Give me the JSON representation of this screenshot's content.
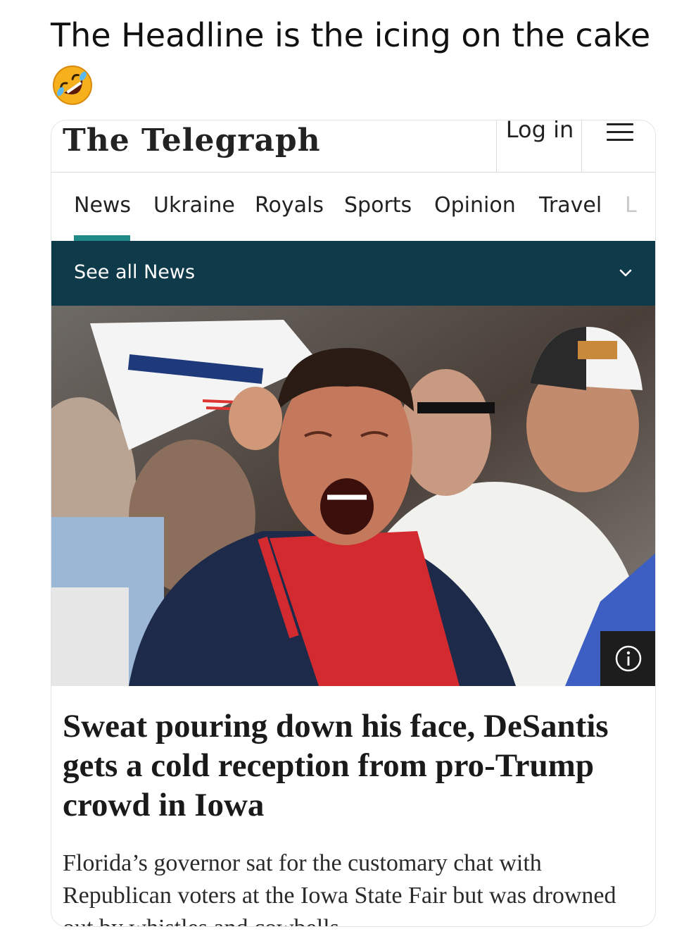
{
  "tweet": {
    "text": "The Headline is the icing on the cake",
    "emoji_icon": "rolling-on-floor-laughing-emoji"
  },
  "site": {
    "brand": "The Telegraph",
    "login_label": "Log in",
    "menu_icon": "hamburger-menu-icon"
  },
  "nav": {
    "items": [
      "News",
      "Ukraine",
      "Royals",
      "Sports",
      "Opinion",
      "Travel"
    ],
    "overflow_hint": "L",
    "active": "News"
  },
  "subnav": {
    "label": "See all News",
    "chevron_icon": "chevron-down-icon"
  },
  "article": {
    "image_icon": "info-icon",
    "headline": "Sweat pouring down his face, DeSantis gets a cold reception from pro-Trump crowd in Iowa",
    "summary": "Florida’s governor sat for the customary chat with Republican voters at the Iowa State Fair but was drowned out by whistles and cowbells"
  },
  "colors": {
    "accent": "#1f8a87",
    "subnav_bg": "#0e3a4a",
    "apron_red": "#d32a2f"
  }
}
